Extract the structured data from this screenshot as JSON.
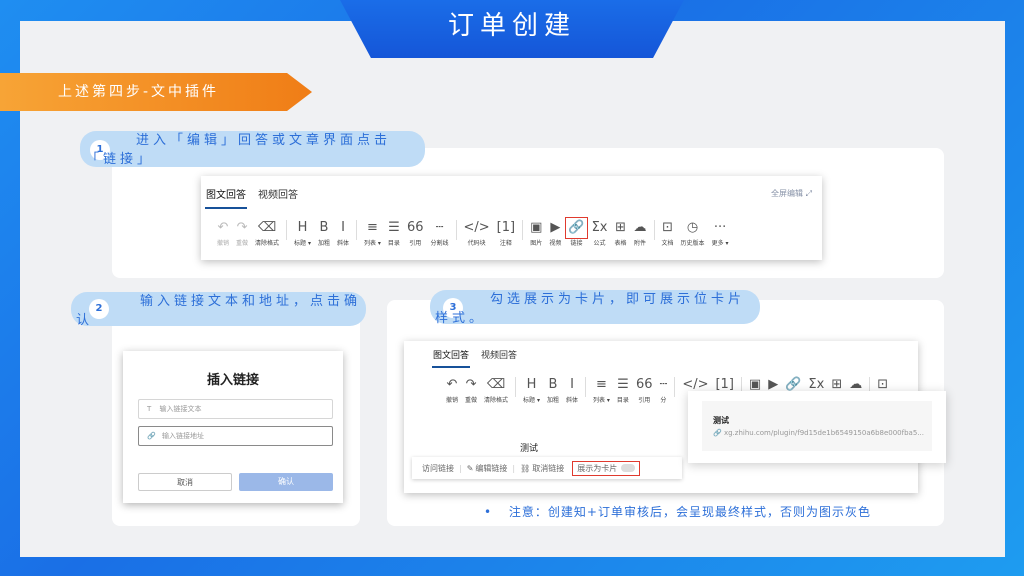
{
  "page_title": "订单创建",
  "section_label": "上述第四步-文中插件",
  "steps": [
    {
      "num": "1",
      "text": "进入「编辑」回答或文章界面点击「链接」"
    },
    {
      "num": "2",
      "text": "输入链接文本和地址，点击确认"
    },
    {
      "num": "3",
      "text": "勾选展示为卡片，即可展示位卡片样式。"
    }
  ],
  "editor": {
    "tab_text_answer": "图文回答",
    "tab_video_answer": "视频回答",
    "fullscreen_label": "全屏编辑",
    "toolbar": [
      {
        "icon": "undo-icon",
        "glyph": "↶",
        "label": "撤销",
        "dim": true
      },
      {
        "icon": "redo-icon",
        "glyph": "↷",
        "label": "重做",
        "dim": true
      },
      {
        "icon": "eraser-icon",
        "glyph": "⌫",
        "label": "清除格式"
      },
      {
        "icon": "heading-icon",
        "glyph": "H",
        "label": "标题 ▾"
      },
      {
        "icon": "bold-icon",
        "glyph": "B",
        "label": "加粗"
      },
      {
        "icon": "italic-icon",
        "glyph": "I",
        "label": "斜体"
      },
      {
        "icon": "list-icon",
        "glyph": "≡",
        "label": "列表 ▾"
      },
      {
        "icon": "toc-icon",
        "glyph": "☰",
        "label": "目录"
      },
      {
        "icon": "quote-icon",
        "glyph": "66",
        "label": "引用"
      },
      {
        "icon": "divider-icon",
        "glyph": "┄",
        "label": "分割线"
      },
      {
        "icon": "code-icon",
        "glyph": "</>",
        "label": "代码块"
      },
      {
        "icon": "footnote-icon",
        "glyph": "[1]",
        "label": "注释"
      },
      {
        "icon": "image-icon",
        "glyph": "▣",
        "label": "图片"
      },
      {
        "icon": "video-icon",
        "glyph": "▶",
        "label": "视频"
      },
      {
        "icon": "link-icon",
        "glyph": "🔗",
        "label": "链接",
        "highlight": true
      },
      {
        "icon": "formula-icon",
        "glyph": "Σx",
        "label": "公式"
      },
      {
        "icon": "table-icon",
        "glyph": "⊞",
        "label": "表格"
      },
      {
        "icon": "attachment-icon",
        "glyph": "☁",
        "label": "附件"
      },
      {
        "icon": "document-icon",
        "glyph": "⊡",
        "label": "文档"
      },
      {
        "icon": "history-icon",
        "glyph": "◷",
        "label": "历史版本"
      },
      {
        "icon": "more-icon",
        "glyph": "···",
        "label": "更多 ▾"
      }
    ]
  },
  "insert_link_dialog": {
    "title": "插入链接",
    "text_placeholder": "输入链接文本",
    "url_placeholder": "输入链接地址",
    "cancel_label": "取消",
    "confirm_label": "确认"
  },
  "step3_editor": {
    "tab_text_answer": "图文回答",
    "tab_video_answer": "视频回答",
    "toolbar": [
      {
        "icon": "undo-icon",
        "glyph": "↶",
        "label": "撤销"
      },
      {
        "icon": "redo-icon",
        "glyph": "↷",
        "label": "重做"
      },
      {
        "icon": "eraser-icon",
        "glyph": "⌫",
        "label": "清除格式"
      },
      {
        "icon": "heading-icon",
        "glyph": "H",
        "label": "标题 ▾"
      },
      {
        "icon": "bold-icon",
        "glyph": "B",
        "label": "加粗"
      },
      {
        "icon": "italic-icon",
        "glyph": "I",
        "label": "斜体"
      },
      {
        "icon": "list-icon",
        "glyph": "≡",
        "label": "列表 ▾"
      },
      {
        "icon": "toc-icon",
        "glyph": "☰",
        "label": "目录"
      },
      {
        "icon": "quote-icon",
        "glyph": "66",
        "label": "引用"
      },
      {
        "icon": "divider-icon",
        "glyph": "┄",
        "label": "分"
      },
      {
        "icon": "code-icon",
        "glyph": "</>",
        "label": ""
      },
      {
        "icon": "footnote-icon",
        "glyph": "[1]",
        "label": ""
      },
      {
        "icon": "image-icon",
        "glyph": "▣",
        "label": ""
      },
      {
        "icon": "video-icon",
        "glyph": "▶",
        "label": ""
      },
      {
        "icon": "link-icon",
        "glyph": "🔗",
        "label": ""
      },
      {
        "icon": "formula-icon",
        "glyph": "Σx",
        "label": ""
      },
      {
        "icon": "table-icon",
        "glyph": "⊞",
        "label": ""
      },
      {
        "icon": "attachment-icon",
        "glyph": "☁",
        "label": ""
      },
      {
        "icon": "document-icon",
        "glyph": "⊡",
        "label": ""
      }
    ],
    "body_text": "测试",
    "linkbar": {
      "visit": "访问链接",
      "edit": "编辑链接",
      "cancel": "取消链接",
      "show_as_card": "展示为卡片"
    },
    "card_preview": {
      "title": "测试",
      "url": "xg.zhihu.com/plugin/f9d15de1b6549150a6b8e000fba5..."
    }
  },
  "note": "注意：创建知+订单审核后，会呈现最终样式，否则为图示灰色",
  "note_bullet": "•"
}
